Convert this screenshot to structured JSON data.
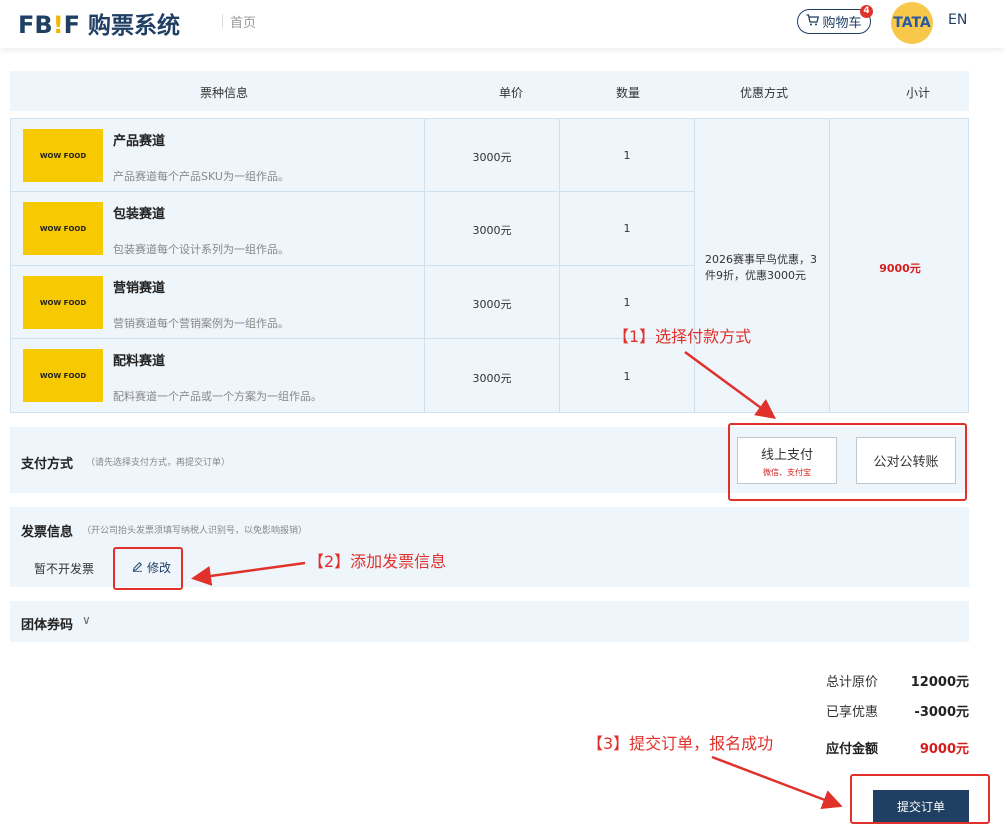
{
  "header": {
    "logo_fb": "FB",
    "logo_bang": "!",
    "logo_f": "F",
    "logo_cn": "购票系统",
    "home": "首页",
    "cart_label": "购物车",
    "cart_count": "4",
    "avatar_text": "TATA",
    "lang": "EN"
  },
  "table": {
    "headers": [
      "票种信息",
      "单价",
      "数量",
      "优惠方式",
      "小计"
    ],
    "rows": [
      {
        "name": "产品赛道",
        "desc": "产品赛道每个产品SKU为一组作品。",
        "price": "3000元",
        "qty": "1"
      },
      {
        "name": "包装赛道",
        "desc": "包装赛道每个设计系列为一组作品。",
        "price": "3000元",
        "qty": "1"
      },
      {
        "name": "营销赛道",
        "desc": "营销赛道每个营销案例为一组作品。",
        "price": "3000元",
        "qty": "1"
      },
      {
        "name": "配料赛道",
        "desc": "配料赛道一个产品或一个方案为一组作品。",
        "price": "3000元",
        "qty": "1"
      }
    ],
    "image_text": "WOW FOOD",
    "discount": "2026赛事早鸟优惠，3件9折，优惠3000元",
    "subtotal": "9000元"
  },
  "payment": {
    "title": "支付方式",
    "hint": "（请先选择支付方式，再提交订单）",
    "online_label": "线上支付",
    "online_sub": "微信、支付宝",
    "transfer_label": "公对公转账"
  },
  "invoice": {
    "title": "发票信息",
    "hint": "（开公司抬头发票须填写纳税人识别号，以免影响报销）",
    "value": "暂不开发票",
    "edit_label": "修改"
  },
  "coupon": {
    "title": "团体券码",
    "chevron": "∨"
  },
  "summary": {
    "original_label": "总计原价",
    "original_value": "12000元",
    "discount_label": "已享优惠",
    "discount_value": "-3000元",
    "payable_label": "应付金额",
    "payable_value": "9000元",
    "submit_label": "提交订单"
  },
  "annotations": {
    "note1": "【1】选择付款方式",
    "note2": "【2】添加发票信息",
    "note3": "【3】提交订单，报名成功"
  },
  "colors": {
    "brand": "#1f3f63",
    "accent_red": "#e0312b",
    "panel_bg": "#eef5fb",
    "logo_yellow": "#f6c900"
  }
}
